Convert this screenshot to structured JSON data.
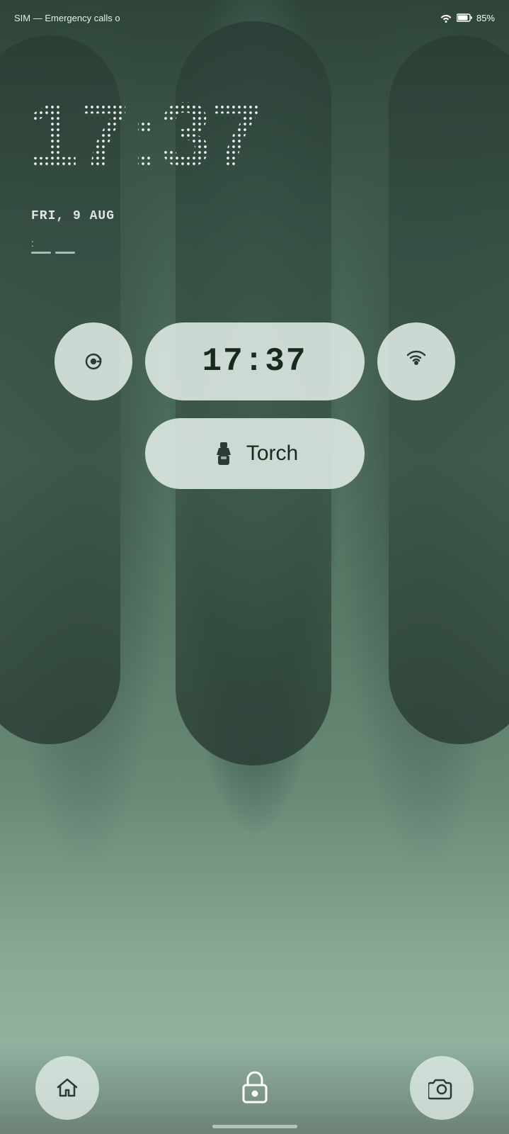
{
  "status_bar": {
    "sim_text": "SIM — Emergency calls o",
    "battery_percent": "85%"
  },
  "clock": {
    "big_time": "17:37",
    "pill_time": "17:37",
    "colon_separator": ":"
  },
  "date": {
    "text": "FRI, 9 AUG"
  },
  "controls": {
    "left_icon": "rotate-icon",
    "right_icon": "wifi-broadcast-icon"
  },
  "torch": {
    "label": "Torch",
    "icon": "flashlight-icon"
  },
  "bottom_bar": {
    "left_icon": "home-icon",
    "center_icon": "lock-icon",
    "right_icon": "camera-icon"
  }
}
